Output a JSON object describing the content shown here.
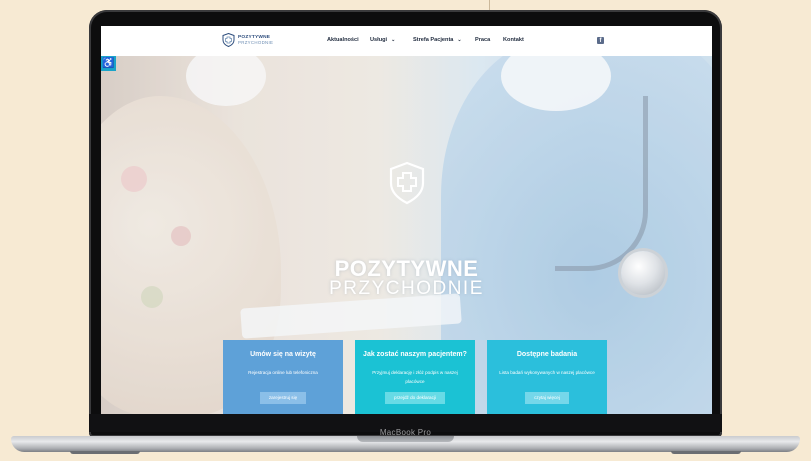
{
  "site": {
    "logo": {
      "line1": "POZYTYWNE",
      "line2": "PRZYCHODNIE"
    },
    "nav": [
      {
        "label": "Aktualności",
        "has_dropdown": false
      },
      {
        "label": "Usługi",
        "has_dropdown": true
      },
      {
        "label": "Strefa Pacjenta",
        "has_dropdown": true
      },
      {
        "label": "Praca",
        "has_dropdown": false
      },
      {
        "label": "Kontakt",
        "has_dropdown": false
      }
    ],
    "social_icon": "facebook-icon",
    "accessibility_icon": "wheelchair-icon"
  },
  "hero": {
    "title": "POZYTYWNE",
    "subtitle": "PRZYCHODNIE"
  },
  "cards": [
    {
      "title": "Umów się na wizytę",
      "text": "Rejestracja online lub telefoniczna",
      "button": "zarejestruj się",
      "color": "#5ea1d8"
    },
    {
      "title": "Jak zostać naszym pacjentem?",
      "text": "Przyjmuj deklarację i złóż podpis w naszej placówce",
      "button": "przejdź do deklaracji",
      "color": "#1bc2d4"
    },
    {
      "title": "Dostępne badania",
      "text": "Lista badań wykonywanych w naszej placówce",
      "button": "czytaj więcej",
      "color": "#2bbfdc"
    }
  ],
  "device": {
    "label": "MacBook Pro"
  },
  "colors": {
    "background": "#f7ead3",
    "brand_dark": "#2c4c7c",
    "accent": "#1aa3c8"
  }
}
